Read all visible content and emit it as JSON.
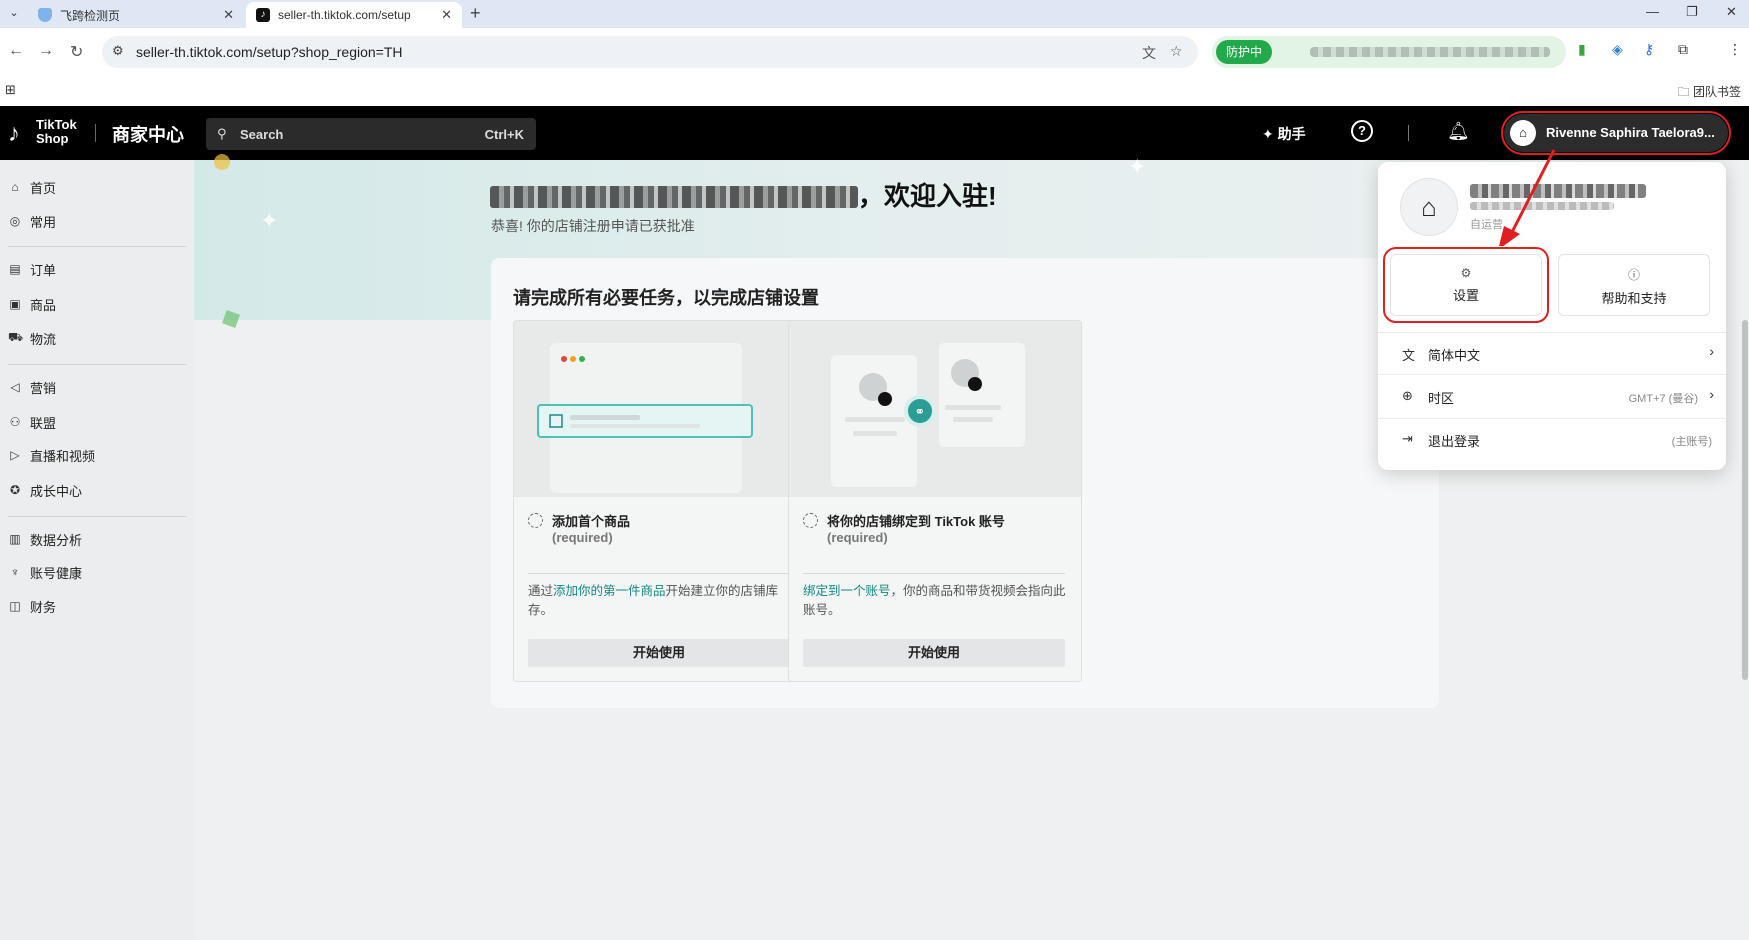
{
  "browser": {
    "tabs": [
      {
        "title": "飞跨检测页",
        "active": false
      },
      {
        "title": "seller-th.tiktok.com/setup",
        "active": true
      }
    ],
    "url": "seller-th.tiktok.com/setup?shop_region=TH",
    "protect_label": "防护中",
    "bookmark_folder": "团队书签"
  },
  "header": {
    "logo_line1": "TikTok",
    "logo_line2": "Shop",
    "brand": "商家中心",
    "search_placeholder": "Search",
    "search_shortcut": "Ctrl+K",
    "assistant": "助手",
    "account_name": "Rivenne Saphira Taelora9..."
  },
  "sidebar": {
    "groups": [
      [
        {
          "label": "首页",
          "icon": "home-icon"
        },
        {
          "label": "常用",
          "icon": "compass-icon"
        }
      ],
      [
        {
          "label": "订单",
          "icon": "clipboard-icon"
        },
        {
          "label": "商品",
          "icon": "box-icon"
        },
        {
          "label": "物流",
          "icon": "truck-icon"
        }
      ],
      [
        {
          "label": "营销",
          "icon": "megaphone-icon"
        },
        {
          "label": "联盟",
          "icon": "people-icon"
        },
        {
          "label": "直播和视频",
          "icon": "video-icon"
        },
        {
          "label": "成长中心",
          "icon": "medal-icon"
        }
      ],
      [
        {
          "label": "数据分析",
          "icon": "chart-icon"
        },
        {
          "label": "账号健康",
          "icon": "trophy-icon"
        },
        {
          "label": "财务",
          "icon": "wallet-icon"
        }
      ]
    ]
  },
  "main": {
    "welcome_suffix": "，欢迎入驻!",
    "subtitle": "恭喜! 你的店铺注册申请已获批准",
    "tasks_title": "请完成所有必要任务，以完成店铺设置",
    "cards": [
      {
        "title": "添加首个商品",
        "required": "(required)",
        "desc_prefix": "通过",
        "desc_link": "添加你的第一件商品",
        "desc_suffix": "开始建立你的店铺库存。",
        "button": "开始使用"
      },
      {
        "title": "将你的店铺绑定到 TikTok 账号",
        "required": "(required)",
        "desc_prefix": "",
        "desc_link": "绑定到一个账号",
        "desc_suffix": "，你的商品和带货视频会指向此账号。",
        "button": "开始使用"
      }
    ]
  },
  "dropdown": {
    "shop_type": "自运营",
    "settings_label": "设置",
    "help_label": "帮助和支持",
    "language_label": "简体中文",
    "timezone_label": "时区",
    "timezone_value": "GMT+7 (曼谷)",
    "logout_label": "退出登录",
    "logout_note": "(主账号)"
  },
  "colors": {
    "accent_link": "#138a82",
    "highlight_red": "#e02020",
    "protect_green": "#22a94b"
  }
}
